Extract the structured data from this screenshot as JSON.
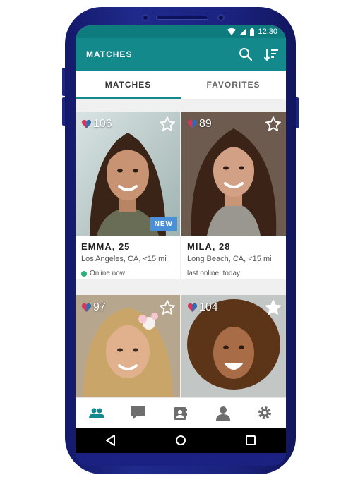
{
  "status_bar": {
    "time": "12:30"
  },
  "app_bar": {
    "title": "MATCHES",
    "icons": [
      "search-icon",
      "sort-icon"
    ]
  },
  "tabs": [
    {
      "label": "MATCHES",
      "active": true
    },
    {
      "label": "FAVORITES",
      "active": false
    }
  ],
  "cards": [
    {
      "hearts": "106",
      "name": "EMMA, 25",
      "location": "Los Angeles, CA, <15 mi",
      "status": "Online now",
      "badge": "NEW",
      "favorited": false
    },
    {
      "hearts": "89",
      "name": "MILA, 28",
      "location": "Long Beach, CA, <15 mi",
      "status": "last online: today",
      "favorited": false
    },
    {
      "hearts": "97",
      "favorited": false
    },
    {
      "hearts": "104",
      "favorited": true
    }
  ],
  "bottom_nav": [
    "people-icon",
    "chat-icon",
    "contacts-icon",
    "profile-icon",
    "settings-icon"
  ],
  "system_nav": [
    "back-icon",
    "home-icon",
    "recents-icon"
  ],
  "colors": {
    "teal": "#14898c",
    "teal_dark": "#0e7b7f",
    "badge_blue": "#4a90d9",
    "online_green": "#2ab27b",
    "phone_body": "#1f2a8c"
  }
}
